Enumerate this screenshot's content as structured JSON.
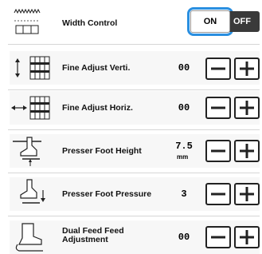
{
  "rows": [
    {
      "label": "Width Control",
      "icon": "width-control-icon",
      "toggle": {
        "on_label": "ON",
        "off_label": "OFF",
        "state": "ON"
      }
    },
    {
      "label": "Fine Adjust Verti.",
      "icon": "fine-adjust-vertical-icon",
      "value": "00"
    },
    {
      "label": "Fine Adjust Horiz.",
      "icon": "fine-adjust-horizontal-icon",
      "value": "00"
    },
    {
      "label": "Presser Foot Height",
      "icon": "presser-foot-height-icon",
      "value": "7.5",
      "unit": "mm"
    },
    {
      "label": "Presser Foot Pressure",
      "icon": "presser-foot-pressure-icon",
      "value": "3"
    },
    {
      "label": "Dual Feed Feed Adjustment",
      "label_lines": [
        "Dual Feed Feed",
        "Adjustment"
      ],
      "icon": "dual-feed-icon",
      "value": "00"
    }
  ],
  "buttons": {
    "minus_icon": "minus-icon",
    "plus_icon": "plus-icon"
  },
  "colors": {
    "highlight": "#2a8fe0",
    "off_bg": "#3a3a3a"
  }
}
